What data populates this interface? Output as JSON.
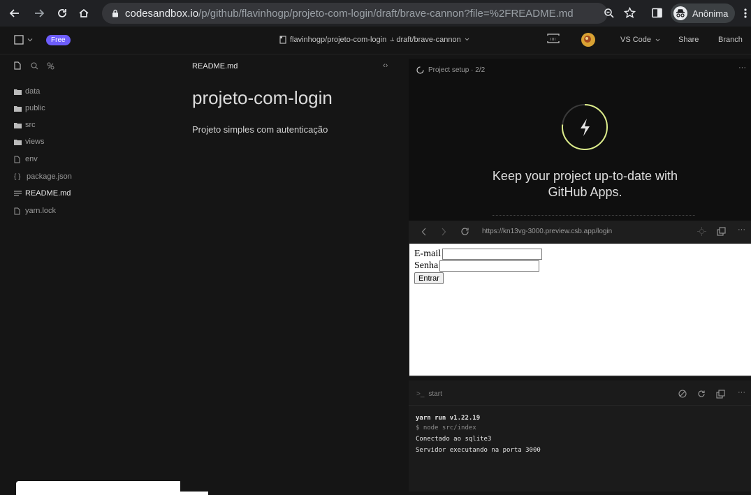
{
  "browser": {
    "url_host": "codesandbox.io",
    "url_path": "/p/github/flavinhogp/projeto-com-login/draft/brave-cannon?file=%2FREADME.md",
    "profile_label": "Anônima"
  },
  "topbar": {
    "plan_badge": "Free",
    "repo_path": "flavinhogp/projeto-com-login",
    "branch_path": "draft/brave-cannon",
    "editor_selector": "VS Code",
    "share_label": "Share",
    "branch_label": "Branch"
  },
  "sidebar": {
    "files": [
      {
        "name": "data",
        "icon": "folder-icon"
      },
      {
        "name": "public",
        "icon": "folder-icon"
      },
      {
        "name": "src",
        "icon": "folder-icon"
      },
      {
        "name": "views",
        "icon": "folder-icon"
      },
      {
        "name": "env",
        "icon": "file-icon"
      },
      {
        "name": "package.json",
        "icon": "braces-icon"
      },
      {
        "name": "README.md",
        "icon": "markdown-icon"
      },
      {
        "name": "yarn.lock",
        "icon": "file-icon"
      }
    ]
  },
  "editor": {
    "tab_label": "README.md",
    "heading": "projeto-com-login",
    "paragraph": "Projeto simples com autenticação"
  },
  "setup": {
    "title": "Project setup · 2/2",
    "headline_line1": "Keep your project up-to-date with",
    "headline_line2": "GitHub Apps."
  },
  "preview": {
    "url": "https://kn13vg-3000.preview.csb.app/login",
    "email_label": "E-mail",
    "password_label": "Senha",
    "submit_label": "Entrar"
  },
  "terminal": {
    "tab_label": "start",
    "lines": [
      "yarn run v1.22.19",
      "$ node src/index",
      "Conectado ao sqlite3",
      "Servidor executando na porta 3000"
    ]
  },
  "colors": {
    "accent": "#6d5dfc",
    "bolt_ring": "#dcec8a"
  }
}
